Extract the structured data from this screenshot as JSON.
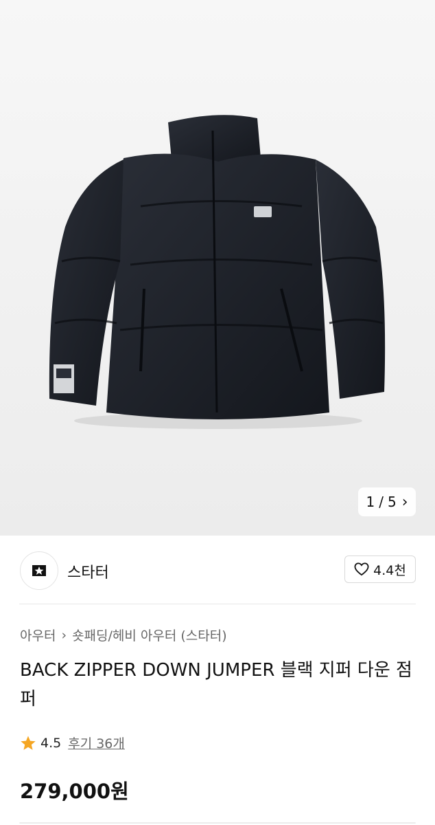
{
  "gallery": {
    "current": "1",
    "separator": "/",
    "total": "5",
    "next_icon": "chevron-right-icon"
  },
  "brand": {
    "name": "스타터",
    "logo_icon": "starter-logo-icon"
  },
  "like": {
    "icon": "heart-outline-icon",
    "count": "4.4천"
  },
  "breadcrumb": {
    "level1": "아우터",
    "separator_icon": "chevron-right-icon",
    "level2": "숏패딩/헤비 아우터 (스타터)"
  },
  "product": {
    "title": "BACK ZIPPER DOWN JUMPER 블랙 지퍼 다운 점퍼",
    "rating": "4.5",
    "rating_icon": "star-icon",
    "reviews": "후기 36개",
    "price": "279,000원"
  },
  "colors": {
    "star": "#f5a623",
    "jacket": "#1c1f26",
    "divider": "#e6e6e6"
  }
}
